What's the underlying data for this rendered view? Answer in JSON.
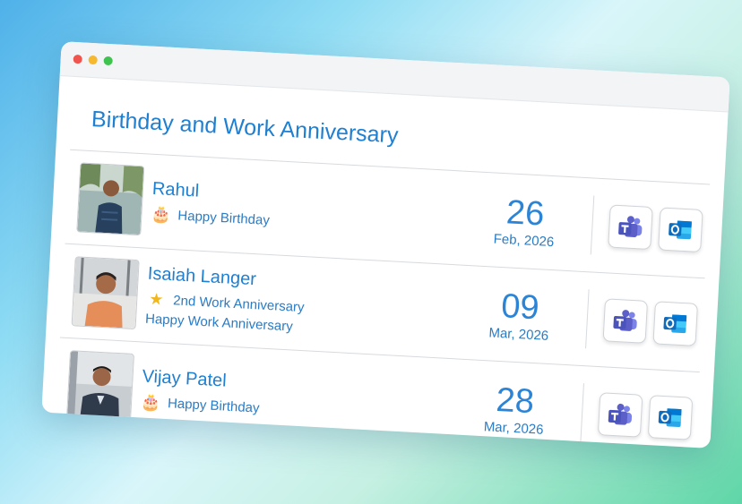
{
  "window": {
    "controls": [
      {
        "name": "close",
        "color": "#f0544f"
      },
      {
        "name": "minimize",
        "color": "#f5b82e"
      },
      {
        "name": "zoom",
        "color": "#3ec44e"
      }
    ]
  },
  "widget": {
    "title": "Birthday and Work Anniversary",
    "entries": [
      {
        "name": "Rahul",
        "events": [
          {
            "icon": "birthday-cake-icon",
            "text": "Happy Birthday"
          }
        ],
        "day": "26",
        "month": "Feb, 2026",
        "actions": [
          {
            "icon": "teams-icon"
          },
          {
            "icon": "outlook-icon"
          }
        ]
      },
      {
        "name": "Isaiah Langer",
        "events": [
          {
            "icon": "star-icon",
            "text": "2nd Work Anniversary"
          },
          {
            "icon": "",
            "text": "Happy Work Anniversary"
          }
        ],
        "day": "09",
        "month": "Mar, 2026",
        "actions": [
          {
            "icon": "teams-icon"
          },
          {
            "icon": "outlook-icon"
          }
        ]
      },
      {
        "name": "Vijay Patel",
        "events": [
          {
            "icon": "birthday-cake-icon",
            "text": "Happy Birthday"
          }
        ],
        "day": "28",
        "month": "Mar, 2026",
        "actions": [
          {
            "icon": "teams-icon"
          },
          {
            "icon": "outlook-icon"
          }
        ]
      }
    ]
  },
  "colors": {
    "accent": "#1f7fd1",
    "teams": "#5b5fc7",
    "outlook": "#0f6cbd"
  }
}
